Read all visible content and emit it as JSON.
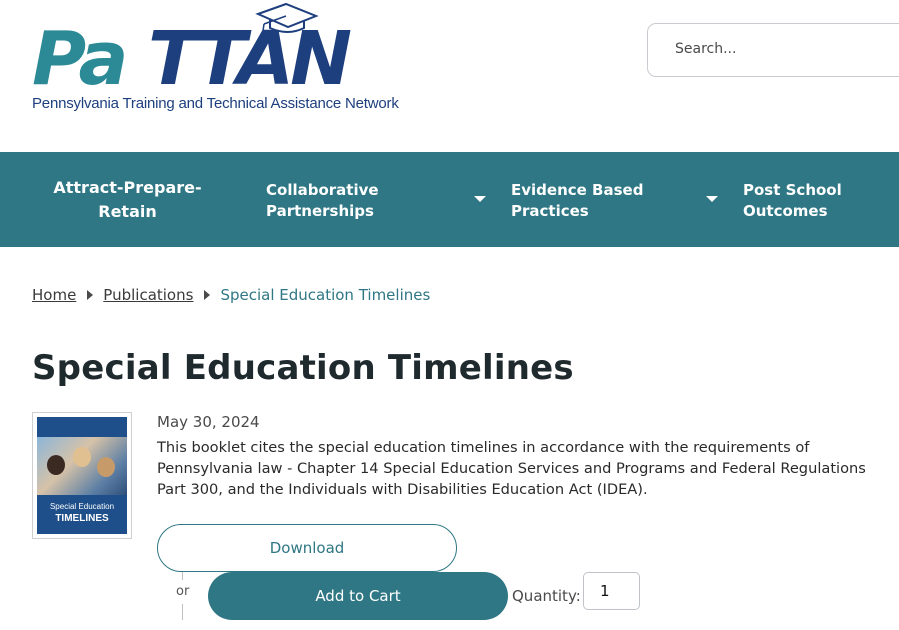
{
  "header": {
    "logo_text": "PaTTAN",
    "logo_subtitle": "Pennsylvania Training and Technical Assistance Network",
    "search_placeholder": "Search..."
  },
  "nav": {
    "items": [
      {
        "label_line1": "Attract-Prepare-",
        "label_line2": "Retain"
      },
      {
        "label_line1": "Collaborative",
        "label_line2": "Partnerships",
        "has_dropdown": true
      },
      {
        "label_line1": "Evidence Based",
        "label_line2": "Practices",
        "has_dropdown": true
      },
      {
        "label_line1": "Post School",
        "label_line2": "Outcomes"
      }
    ]
  },
  "breadcrumb": {
    "home": "Home",
    "publications": "Publications",
    "current": "Special Education Timelines"
  },
  "page": {
    "title": "Special Education Timelines",
    "date": "May 30, 2024",
    "description": "This booklet cites the special education timelines in accordance with the requirements of Pennsylvania law -  Chapter 14 Special Education Services and Programs and Federal Regulations Part 300, and the Individuals with Disabilities Education Act (IDEA).",
    "cover_title_line1": "Special Education",
    "cover_title_line2": "TIMELINES"
  },
  "actions": {
    "download_label": "Download",
    "or_label": "or",
    "add_to_cart_label": "Add to Cart",
    "quantity_label": "Quantity:",
    "quantity_value": "1"
  },
  "colors": {
    "teal": "#2f7784",
    "logo_teal": "#2c8a96",
    "logo_navy": "#1d3f7e"
  }
}
